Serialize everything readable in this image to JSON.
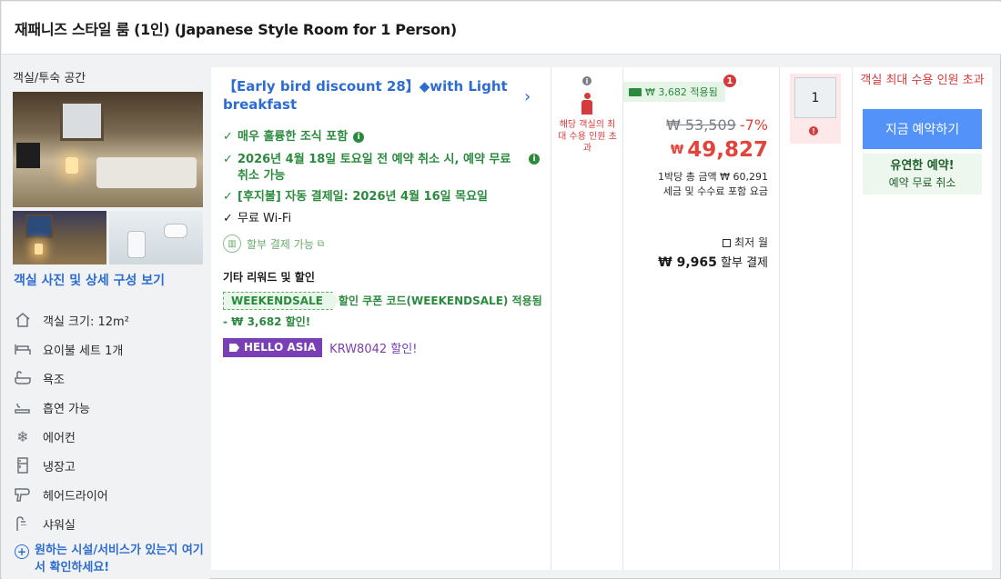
{
  "room_title": "재패니즈 스타일 룸 (1인) (Japanese Style Room for 1 Person)",
  "left": {
    "caption": "객실/투숙 공간",
    "see_photos": "객실 사진 및 상세 구성 보기",
    "amenities": [
      {
        "icon": "area-icon",
        "label": "객실 크기: 12m²"
      },
      {
        "icon": "bed-icon",
        "label": "요이불 세트 1개"
      },
      {
        "icon": "bathtub-icon",
        "label": "욕조"
      },
      {
        "icon": "smoking-icon",
        "label": "흡연 가능"
      },
      {
        "icon": "snowflake-icon",
        "label": "에어컨"
      },
      {
        "icon": "fridge-icon",
        "label": "냉장고"
      },
      {
        "icon": "hairdryer-icon",
        "label": "헤어드라이어"
      },
      {
        "icon": "shower-icon",
        "label": "샤워실"
      }
    ],
    "more_facilities": "원하는 시설/서비스가 있는지 여기서 확인하세요!"
  },
  "deal": {
    "title": "【Early bird discount 28】◆with Light breakfast",
    "features": [
      {
        "text": "매우 훌륭한 조식 포함",
        "style": "green"
      },
      {
        "text": "2026년 4월 18일 토요일 전 예약 취소 시, 예약 무료 취소 가능",
        "style": "green"
      },
      {
        "text": "[후지불] 자동 결제일: 2026년 4월 16일 목요일",
        "style": "green"
      },
      {
        "text": "무료 Wi-Fi",
        "style": "black"
      }
    ],
    "installment": "할부 결제 가능",
    "other_rewards": "기타 리워드 및 할인",
    "coupon_code": "WEEKENDSALE",
    "coupon_text": "할인 쿠폰 코드(WEEKENDSALE) 적용됨",
    "coupon_amount": "- ₩ 3,682 할인!",
    "promo_badge": "HELLO ASIA",
    "promo_text": "KRW8042 할인!"
  },
  "occupancy": {
    "text": "해당 객실의 최대 수용 인원 초과"
  },
  "price": {
    "saved_badge": "₩ 3,682 적용됨",
    "badge_count": "1",
    "original": "₩ 53,509",
    "discount_pct": "-7%",
    "currency": "₩",
    "amount": "49,827",
    "total_line1": "1박당 총 금액 ₩ 60,291",
    "total_line2": "세금 및 수수료 포함 요금",
    "min_label": "최저 월",
    "min_amount": "₩ 9,965",
    "min_suffix": " 할부 결제"
  },
  "qty": {
    "value": "1",
    "error_icon": "!"
  },
  "booking": {
    "max_capacity": "객실 최대 수용 인원 초과",
    "book_button": "지금 예약하기",
    "flex_title": "유연한 예약!",
    "flex_sub": "예약 무료 취소"
  },
  "colors": {
    "accent_blue": "#2d6cd1",
    "button_blue": "#5392f9",
    "green": "#2b8a3e",
    "red": "#d63a3a",
    "purple": "#7a3fb4"
  }
}
